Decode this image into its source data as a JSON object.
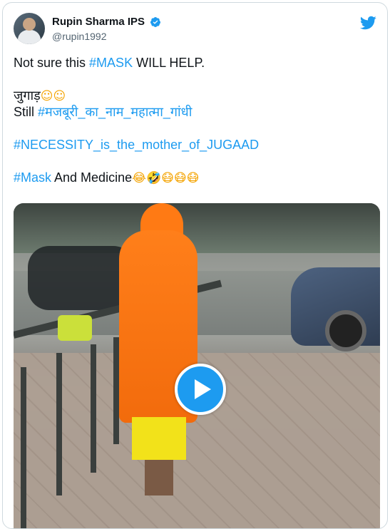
{
  "author": {
    "name": "Rupin Sharma IPS",
    "handle": "@rupin1992",
    "verified": true
  },
  "tweet": {
    "line1_plain": "Not sure this ",
    "line1_tag": "#MASK",
    "line1_rest": " WILL HELP.",
    "line2_plain": "जुगाड़",
    "line2_emoji": "☺☺",
    "line3_plain": "Still ",
    "line3_tag": "#मजबूरी_का_नाम_महात्मा_गांधी",
    "line4_tag": "#NECESSITY_is_the_mother_of_JUGAAD",
    "line5_tag": "#Mask",
    "line5_rest": " And Medicine",
    "line5_emoji": "😂🤣😷😷😷"
  },
  "media": {
    "type": "video",
    "play_icon": "play-icon"
  },
  "icons": {
    "brand": "twitter-bird-icon",
    "verified": "verified-badge-icon"
  },
  "colors": {
    "accent": "#1d9bf0",
    "text": "#0f1419",
    "secondary": "#536471"
  }
}
